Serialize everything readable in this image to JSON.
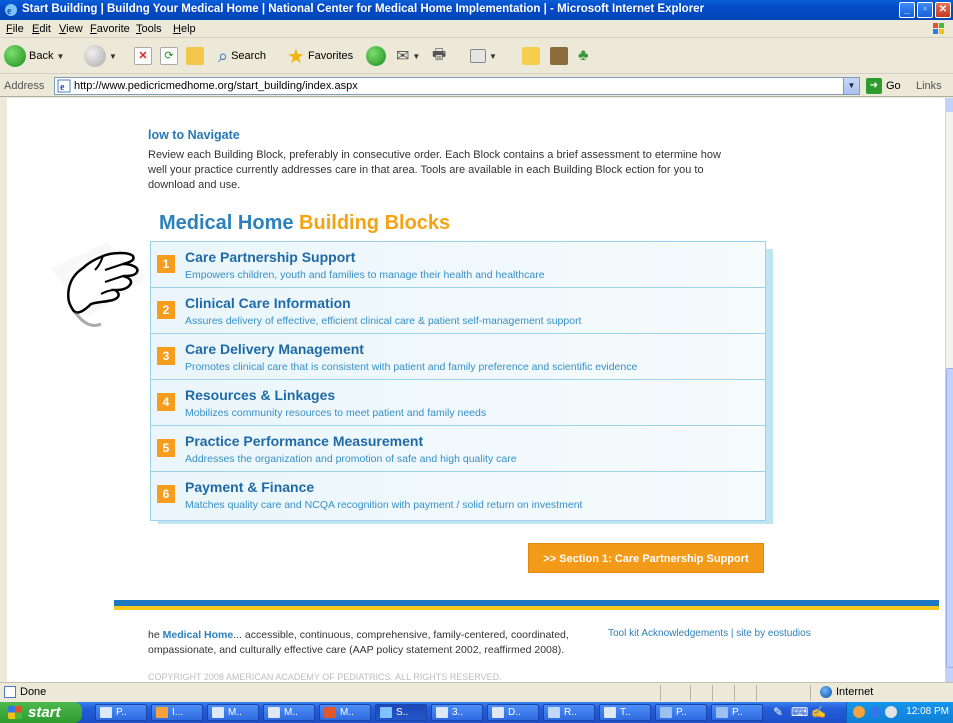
{
  "window": {
    "title": "Start Building | Buildng Your Medical Home | National Center for Medical Home Implementation | - Microsoft Internet Explorer"
  },
  "menu": [
    "File",
    "Edit",
    "View",
    "Favorite",
    "Tools",
    "Help"
  ],
  "toolbar": {
    "back": "Back",
    "search": "Search",
    "favorites": "Favorites"
  },
  "address": {
    "label": "Address",
    "url": "http://www.pedicricmedhome.org/start_building/index.aspx",
    "go": "Go",
    "links": "Links"
  },
  "page": {
    "nav_heading": "low to Navigate",
    "nav_text": "Review each Building Block, preferably in consecutive order. Each Block contains a brief assessment to etermine how well your practice currently addresses care in that area. Tools are available in each Building Block ection for you to download and use.",
    "title_part1": "Medical Home",
    "title_part2": "Building Blocks",
    "blocks": [
      {
        "num": "1",
        "name": "Care Partnership Support",
        "desc": "Empowers children, youth and families to manage their health and healthcare"
      },
      {
        "num": "2",
        "name": "Clinical Care Information",
        "desc": "Assures delivery of effective, efficient clinical care & patient self-management support"
      },
      {
        "num": "3",
        "name": "Care Delivery Management",
        "desc": "Promotes clinical care that is consistent with patient and family preference and scientific evidence"
      },
      {
        "num": "4",
        "name": "Resources & Linkages",
        "desc": "Mobilizes community resources to meet patient and family needs"
      },
      {
        "num": "5",
        "name": "Practice Performance Measurement",
        "desc": "Addresses the organization and promotion of safe and high quality care"
      },
      {
        "num": "6",
        "name": "Payment & Finance",
        "desc": "Matches quality care and NCQA recognition with payment / solid return on investment"
      }
    ],
    "section_button": ">> Section 1: Care Partnership Support",
    "footer_prefix": "he",
    "footer_mh": "Medical Home",
    "footer_text": "... accessible, continuous, comprehensive, family-centered, coordinated, ompassionate, and culturally effective care (AAP policy statement 2002, reaffirmed 2008).",
    "footer_links": "Tool kit Acknowledgements | site by eostudios",
    "copyright": "COPYRIGHT 2008 AMERICAN ACADEMY OF PEDIATRICS. ALL RIGHTS RESERVED."
  },
  "status": {
    "text": "Done",
    "zone": "Internet"
  },
  "taskbar": {
    "start": "start",
    "tasks": [
      "P..",
      "I...",
      "M..",
      "M..",
      "M..",
      "S..",
      "3..",
      "D..",
      "R..",
      "T..",
      "P..",
      "P.."
    ],
    "clock": "12:08 PM"
  },
  "colors": {
    "accent_blue": "#2b80bd",
    "accent_orange": "#f5a313",
    "titlebar": "#0449c6"
  }
}
